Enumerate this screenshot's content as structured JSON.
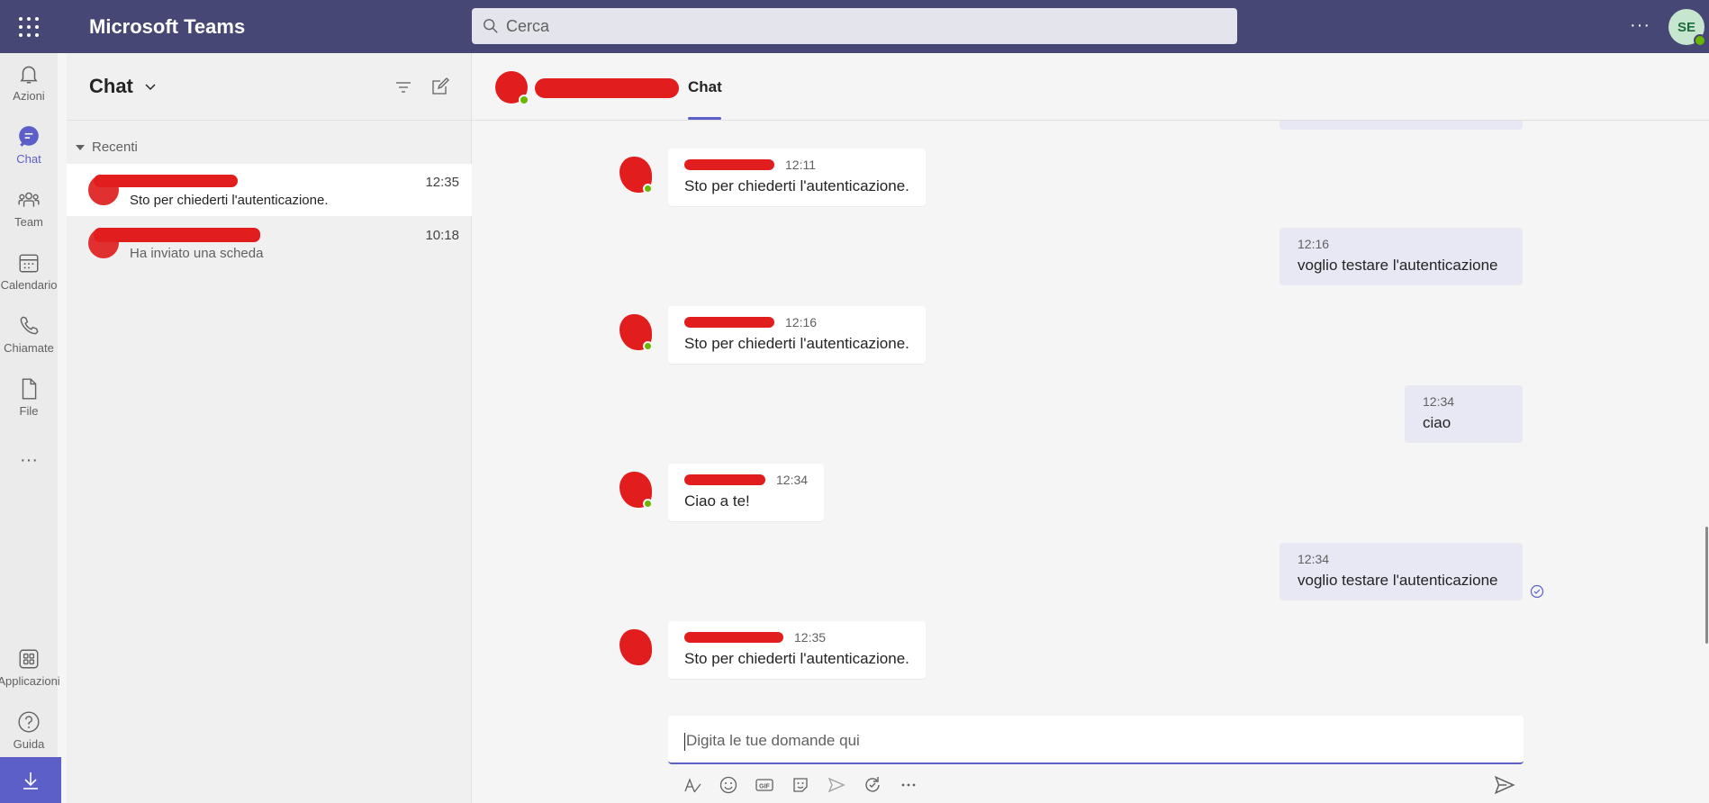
{
  "app": {
    "title": "Microsoft Teams",
    "search_placeholder": "Cerca",
    "more_label": "···",
    "user_initials": "SE",
    "colors": {
      "header": "#464775",
      "accent": "#5b5fc7",
      "status_available": "#6bb700"
    }
  },
  "rail": {
    "items": [
      {
        "label": "Azioni",
        "icon": "bell-icon"
      },
      {
        "label": "Chat",
        "icon": "chat-icon"
      },
      {
        "label": "Team",
        "icon": "team-icon"
      },
      {
        "label": "Calendario",
        "icon": "calendar-icon"
      },
      {
        "label": "Chiamate",
        "icon": "phone-icon"
      },
      {
        "label": "File",
        "icon": "file-icon"
      },
      {
        "label": "···",
        "icon": "more-icon"
      },
      {
        "label": "Applicazioni",
        "icon": "apps-icon"
      },
      {
        "label": "Guida",
        "icon": "help-icon"
      }
    ],
    "download_icon": "download-icon"
  },
  "chatlist": {
    "title": "Chat",
    "section": "Recenti",
    "items": [
      {
        "preview": "Sto per chiederti l'autenticazione.",
        "time": "12:35",
        "selected": true
      },
      {
        "preview": "Ha inviato una scheda",
        "time": "10:18",
        "selected": false
      }
    ]
  },
  "chat": {
    "tab": "Chat",
    "messages": [
      {
        "side": "left",
        "time": "12:11",
        "text": "Sto per chiederti l'autenticazione."
      },
      {
        "side": "right",
        "time": "12:16",
        "text": "voglio testare l'autenticazione"
      },
      {
        "side": "left",
        "time": "12:16",
        "text": "Sto per chiederti l'autenticazione."
      },
      {
        "side": "right",
        "time": "12:34",
        "text": "ciao"
      },
      {
        "side": "left",
        "time": "12:34",
        "text": "Ciao a te!"
      },
      {
        "side": "right",
        "time": "12:34",
        "text": "voglio testare l'autenticazione"
      },
      {
        "side": "left",
        "time": "12:35",
        "text": "Sto per chiederti l'autenticazione."
      }
    ],
    "compose_placeholder": "Digita le tue domande qui"
  }
}
